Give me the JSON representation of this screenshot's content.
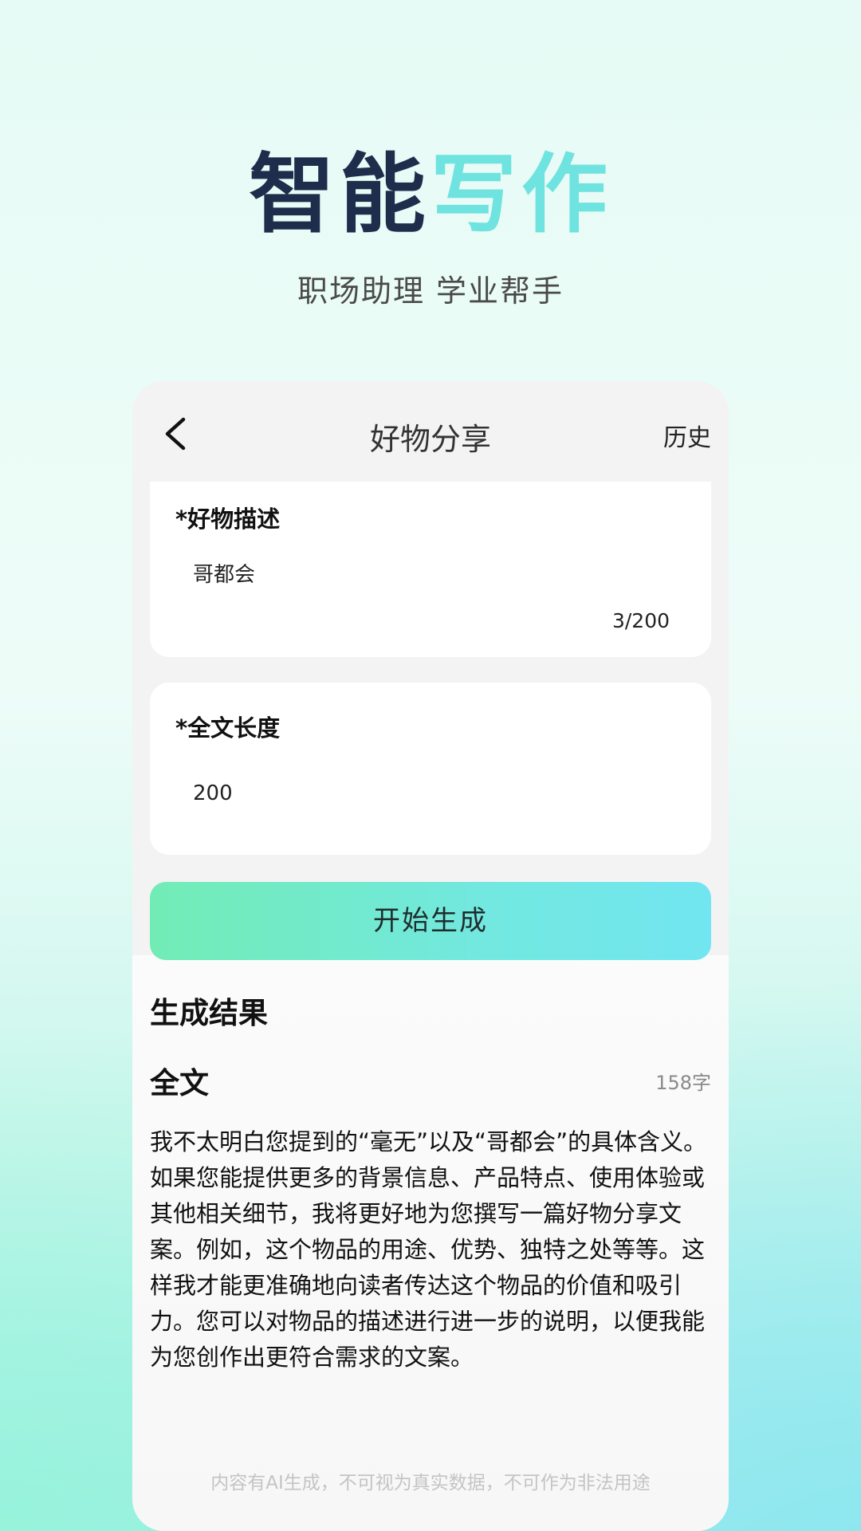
{
  "hero": {
    "title_part1": "智能",
    "title_part2": "写作",
    "subtitle": "职场助理 学业帮手"
  },
  "nav": {
    "back_icon": "chevron-left-icon",
    "title": "好物分享",
    "history_label": "历史"
  },
  "form": {
    "description": {
      "label": "*好物描述",
      "value": "哥都会",
      "counter": "3/200"
    },
    "length": {
      "label": "*全文长度",
      "value": "200"
    }
  },
  "generate_button": "开始生成",
  "result": {
    "title": "生成结果",
    "full_label": "全文",
    "word_count": "158字",
    "text": "我不太明白您提到的“毫无”以及“哥都会”的具体含义。如果您能提供更多的背景信息、产品特点、使用体验或其他相关细节，我将更好地为您撰写一篇好物分享文案。例如，这个物品的用途、优势、独特之处等等。这样我才能更准确地向读者传达这个物品的价值和吸引力。您可以对物品的描述进行进一步的说明，以便我能为您创作出更符合需求的文案。"
  },
  "disclaimer": "内容有AI生成，不可视为真实数据，不可作为非法用途",
  "colors": {
    "title_dark": "#1f2d4d",
    "title_accent": "#6fe3df",
    "button_start": "#72ecb5",
    "button_end": "#72e6f0"
  }
}
